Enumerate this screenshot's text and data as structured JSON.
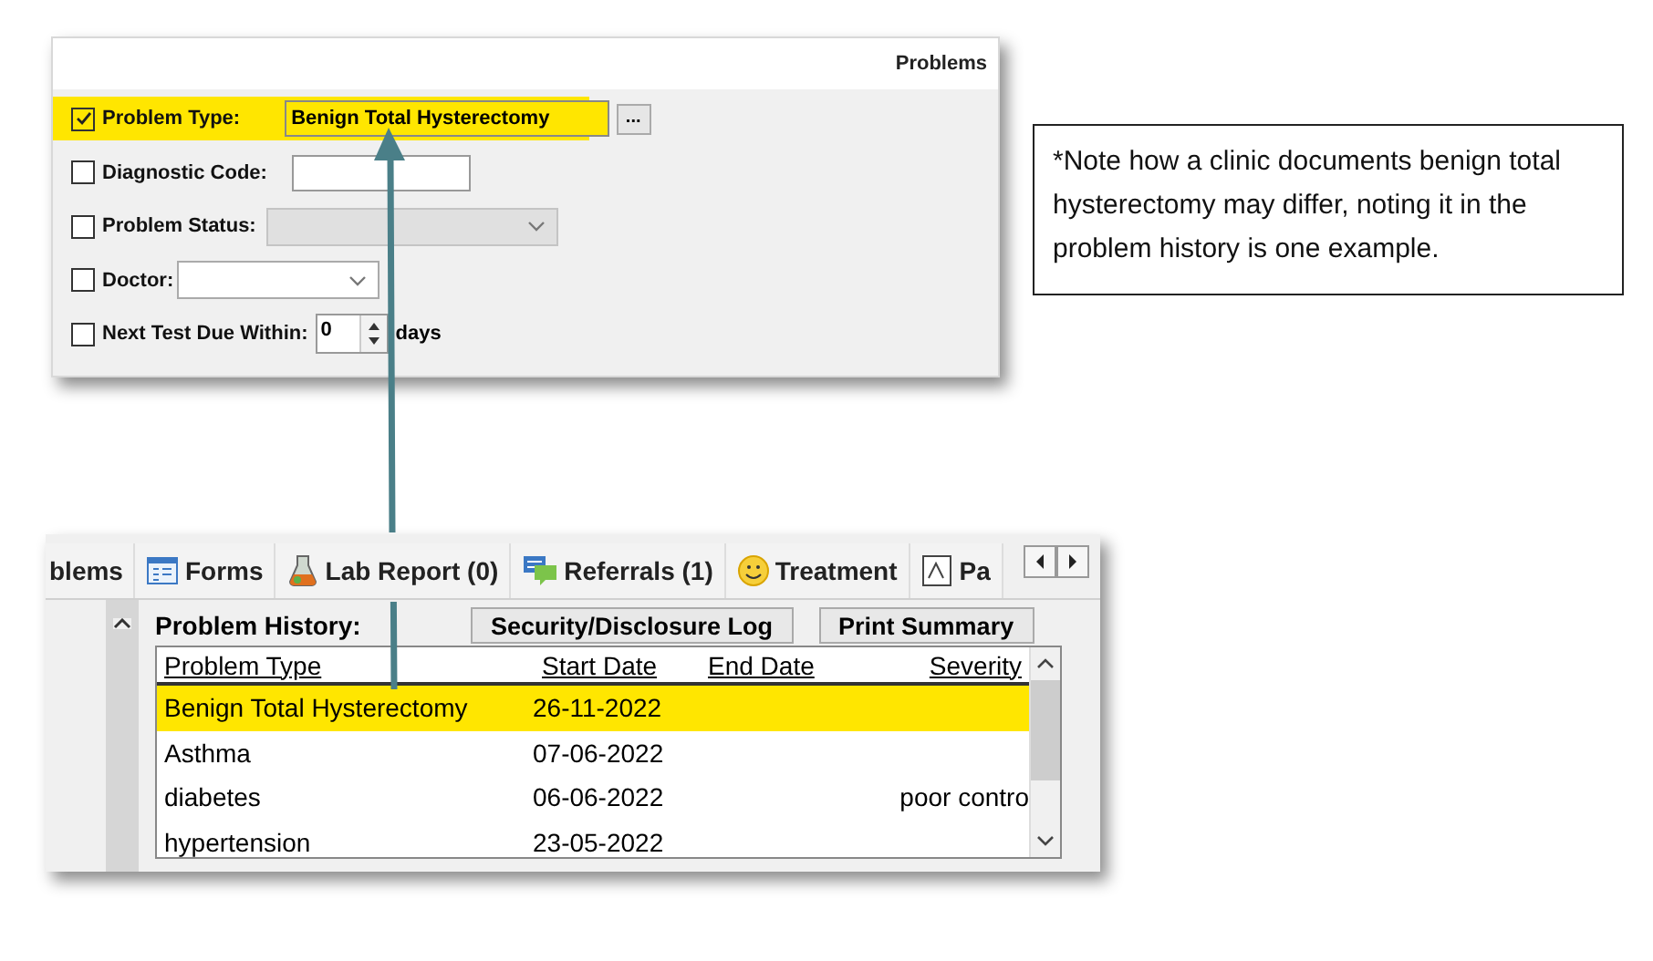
{
  "problems_panel": {
    "title": "Problems",
    "fields": [
      {
        "kind": "text",
        "label": "Problem Type:",
        "checked": true,
        "highlighted": true,
        "value": "Benign Total Hysterectomy",
        "button": "..."
      },
      {
        "kind": "text",
        "label": "Diagnostic Code:",
        "checked": false,
        "highlighted": false
      },
      {
        "kind": "select",
        "label": "Problem Status:",
        "checked": false,
        "highlighted": false,
        "disabled": true
      },
      {
        "kind": "select",
        "label": "Doctor:",
        "checked": false,
        "highlighted": false,
        "disabled": false
      },
      {
        "kind": "spinner",
        "label": "Next Test Due Within:",
        "checked": false,
        "highlighted": false,
        "value": "0",
        "suffix": "days"
      }
    ]
  },
  "note": "*Note how a clinic documents benign total hysterectomy may differ, noting it in the problem history is one example.",
  "record_panel": {
    "tabs": [
      {
        "label": "blems",
        "selected": false
      },
      {
        "label": "Forms",
        "selected": false
      },
      {
        "label": "Lab Report (0)",
        "selected": false
      },
      {
        "label": "Referrals (1)",
        "selected": false
      },
      {
        "label": "Treatment",
        "selected": false
      },
      {
        "label": "Pa",
        "selected": false
      }
    ],
    "section_title": "Problem History:",
    "buttons": [
      "Security/Disclosure Log",
      "Print Summary"
    ],
    "columns": [
      "Problem Type",
      "Start Date",
      "End Date",
      "Severity"
    ],
    "rows": [
      {
        "cells": [
          "Benign Total Hysterectomy",
          "26-11-2022",
          "",
          ""
        ],
        "highlighted": true
      },
      {
        "cells": [
          "Asthma",
          "07-06-2022",
          "",
          ""
        ],
        "highlighted": false
      },
      {
        "cells": [
          "diabetes",
          "06-06-2022",
          "",
          "poor contro"
        ],
        "highlighted": false
      },
      {
        "cells": [
          "hypertension",
          "23-05-2022",
          "",
          ""
        ],
        "highlighted": false
      }
    ]
  }
}
